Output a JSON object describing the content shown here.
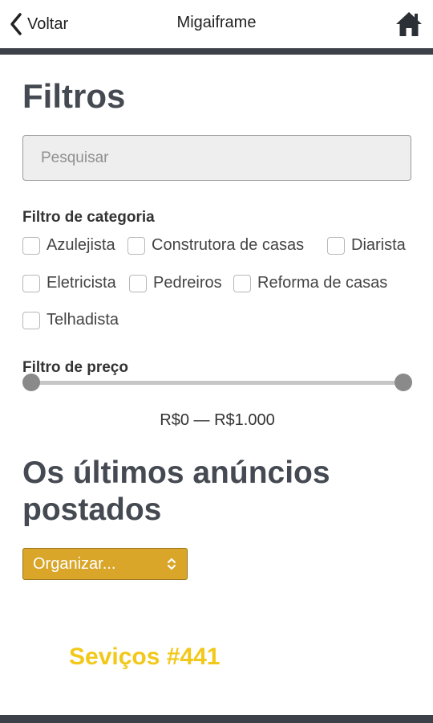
{
  "header": {
    "back_label": "Voltar",
    "title": "Migaiframe",
    "back_icon": "chevron-left-icon",
    "home_icon": "home-icon"
  },
  "filters": {
    "title": "Filtros",
    "search_placeholder": "Pesquisar",
    "category_label": "Filtro de categoria",
    "categories": [
      {
        "label": "Azulejista",
        "checked": false
      },
      {
        "label": "Construtora de casas",
        "checked": false
      },
      {
        "label": "Diarista",
        "checked": false
      },
      {
        "label": "Eletricista",
        "checked": false
      },
      {
        "label": "Pedreiros",
        "checked": false
      },
      {
        "label": "Reforma de casas",
        "checked": false
      },
      {
        "label": "Telhadista",
        "checked": false
      }
    ],
    "price_label": "Filtro de preço",
    "price_range": "R$0 — R$1.000",
    "price_min": 0,
    "price_max": 1000
  },
  "listings": {
    "title": "Os últimos anúncios postados",
    "sort_label": "Organizar..."
  },
  "footer_text": "Seviços #441",
  "colors": {
    "accent": "#d9a62a",
    "highlight_text": "#f2c81a",
    "bar": "#3c4048",
    "heading": "#454a52"
  }
}
